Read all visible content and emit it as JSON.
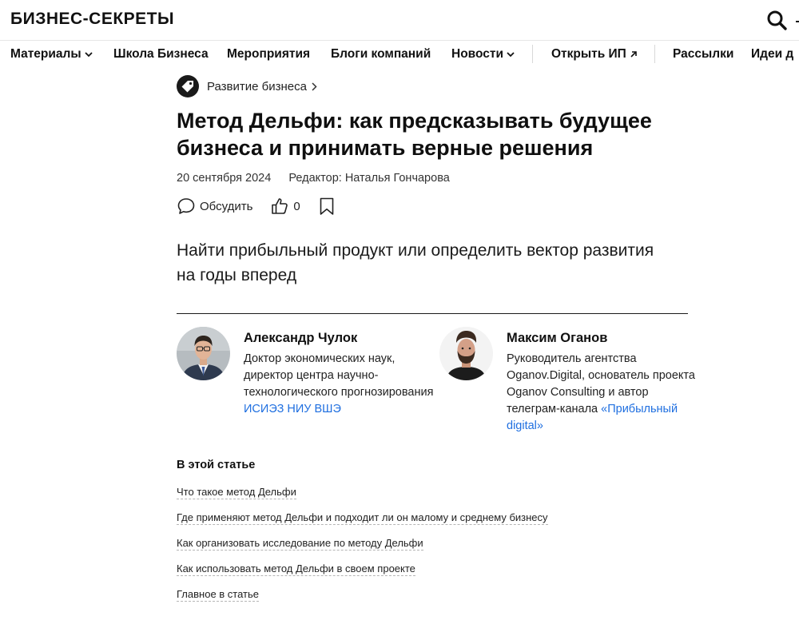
{
  "header": {
    "logo": "БИЗНЕС-СЕКРЕТЫ",
    "search_icon": "search-icon"
  },
  "nav": {
    "items": [
      {
        "label": "Материалы",
        "has_dropdown": true
      },
      {
        "label": "Школа Бизнеса"
      },
      {
        "label": "Мероприятия"
      },
      {
        "label": "Блоги компаний"
      },
      {
        "label": "Новости",
        "has_dropdown": true
      },
      {
        "label": "Открыть ИП",
        "external": true
      },
      {
        "label": "Рассылки"
      },
      {
        "label": "Идеи д"
      }
    ]
  },
  "article": {
    "rubric": "Развитие бизнеса",
    "rubric_icon": "tag-icon",
    "title": "Метод Дельфи: как предсказывать будущее бизнеса и принимать верные решения",
    "date": "20 сентября 2024",
    "editor": "Редактор: Наталья Гончарова",
    "actions": {
      "discuss_label": "Обсудить",
      "likes_count": "0"
    },
    "lead": "Найти прибыльный продукт или определить вектор развития на годы вперед"
  },
  "experts": [
    {
      "name": "Александр Чулок",
      "bio": "Доктор экономических наук, директор центра научно-технологического прогнозирования",
      "link": "ИСИЭЗ НИУ ВШЭ"
    },
    {
      "name": "Максим Оганов",
      "bio": "Руководитель агентства Oganov.Digital, основатель проекта Oganov Consulting и автор телеграм-канала",
      "link": "«Прибыльный digital»"
    }
  ],
  "toc": {
    "title": "В этой статье",
    "items": [
      "Что такое метод Дельфи",
      "Где применяют метод Дельфи и подходит ли он малому и среднему бизнесу",
      "Как организовать исследование по методу Дельфи",
      "Как использовать метод Дельфи в своем проекте",
      "Главное в статье"
    ]
  },
  "colors": {
    "text": "#111111",
    "link": "#1f6fe0",
    "divider": "#e6e6e6"
  }
}
